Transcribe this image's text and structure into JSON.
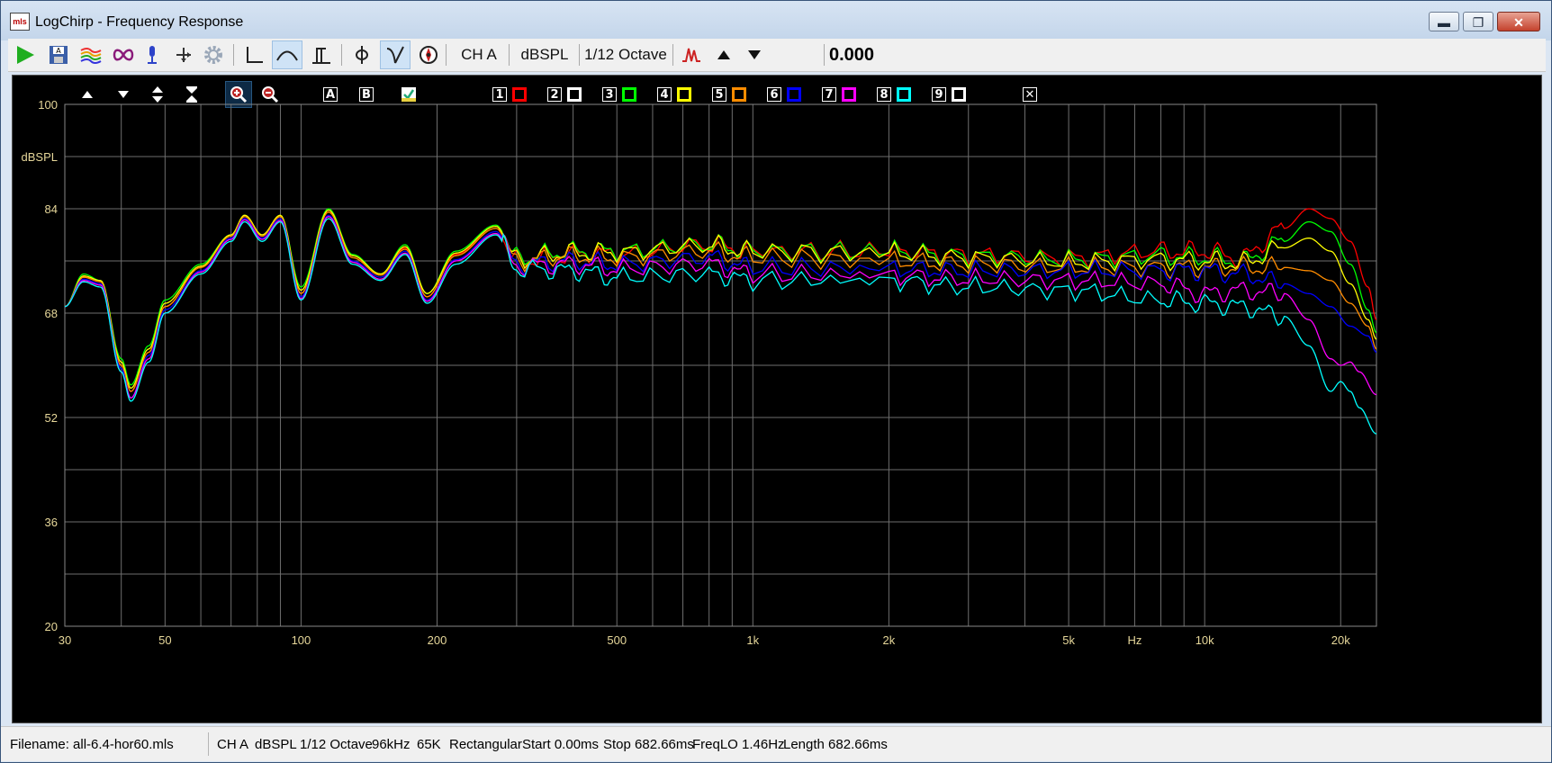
{
  "window": {
    "title": "LogChirp - Frequency Response",
    "app_icon_text": "mls",
    "minimize_label": "▬",
    "maximize_label": "❐",
    "close_label": "✕"
  },
  "toolbar": {
    "buttons": [
      {
        "name": "play-icon",
        "color": "#1fae1f"
      },
      {
        "name": "save-icon"
      },
      {
        "name": "multitrace-icon"
      },
      {
        "name": "infinity-icon"
      },
      {
        "name": "mic-icon"
      },
      {
        "name": "move-icon"
      },
      {
        "name": "gear-icon"
      },
      {
        "name": "impulse-icon"
      },
      {
        "name": "frequency-curve-icon",
        "pressed": true
      },
      {
        "name": "time-window-icon"
      },
      {
        "name": "phase-icon"
      },
      {
        "name": "smoothing-icon",
        "pressed": true
      },
      {
        "name": "compass-icon"
      }
    ],
    "channel": "CH A",
    "units": "dBSPL",
    "smoothing": "1/12 Octave",
    "offset_value": "0.000"
  },
  "plot_toolbar": {
    "labels": [
      "A",
      "B"
    ],
    "numbers": [
      "1",
      "2",
      "3",
      "4",
      "5",
      "6",
      "7",
      "8",
      "9"
    ],
    "trace_colors": [
      "#ff0000",
      "#ffffff",
      "#00ff00",
      "#ffff00",
      "#ff8c00",
      "#0000ff",
      "#ff00ff",
      "#00ffff",
      "#ffffff"
    ],
    "close_label": "✕"
  },
  "chart_data": {
    "type": "line",
    "ylabel": "dBSPL",
    "xlabel": "Hz",
    "x_scale": "log",
    "xlim": [
      30,
      24000
    ],
    "ylim": [
      20,
      100
    ],
    "y_ticks": [
      "100",
      "84",
      "68",
      "52",
      "36",
      "20"
    ],
    "x_ticks": [
      {
        "value": 30,
        "label": "30"
      },
      {
        "value": 50,
        "label": "50"
      },
      {
        "value": 100,
        "label": "100"
      },
      {
        "value": 200,
        "label": "200"
      },
      {
        "value": 500,
        "label": "500"
      },
      {
        "value": 1000,
        "label": "1k"
      },
      {
        "value": 2000,
        "label": "2k"
      },
      {
        "value": 5000,
        "label": "5k"
      },
      {
        "value": 7000,
        "label": "Hz"
      },
      {
        "value": 10000,
        "label": "10k"
      },
      {
        "value": 20000,
        "label": "20k"
      }
    ],
    "background": "#000000",
    "grid": true,
    "grid_color": "#6e6e6e",
    "tick_label_color": "#e6d79a",
    "series": [
      {
        "color": "#ff0000",
        "points": [
          [
            30,
            69
          ],
          [
            33,
            73.5
          ],
          [
            36,
            73
          ],
          [
            40,
            60
          ],
          [
            42,
            56
          ],
          [
            46,
            62
          ],
          [
            50,
            69
          ],
          [
            60,
            75
          ],
          [
            70,
            80
          ],
          [
            75,
            83
          ],
          [
            82,
            80
          ],
          [
            90,
            83
          ],
          [
            100,
            71
          ],
          [
            115,
            83.5
          ],
          [
            130,
            76.5
          ],
          [
            150,
            74
          ],
          [
            170,
            78
          ],
          [
            190,
            70.5
          ],
          [
            220,
            77
          ],
          [
            270,
            81
          ],
          [
            300,
            76
          ],
          [
            400,
            77
          ],
          [
            500,
            77
          ],
          [
            800,
            78.5
          ],
          [
            1000,
            77.5
          ],
          [
            2000,
            77.5
          ],
          [
            3000,
            77
          ],
          [
            5000,
            76.5
          ],
          [
            8000,
            77.5
          ],
          [
            10000,
            77.5
          ],
          [
            12000,
            76.5
          ],
          [
            15000,
            81
          ],
          [
            17000,
            84
          ],
          [
            19000,
            82.5
          ],
          [
            21000,
            79
          ],
          [
            23000,
            72
          ],
          [
            24000,
            67
          ]
        ]
      },
      {
        "color": "#00ff00",
        "points": [
          [
            30,
            69
          ],
          [
            33,
            74
          ],
          [
            36,
            73
          ],
          [
            40,
            61
          ],
          [
            42,
            57
          ],
          [
            46,
            63
          ],
          [
            50,
            70
          ],
          [
            60,
            75.5
          ],
          [
            70,
            80
          ],
          [
            75,
            83
          ],
          [
            82,
            80
          ],
          [
            90,
            83
          ],
          [
            100,
            72
          ],
          [
            115,
            84
          ],
          [
            130,
            77
          ],
          [
            150,
            74
          ],
          [
            170,
            78.5
          ],
          [
            190,
            71
          ],
          [
            220,
            77.5
          ],
          [
            270,
            81.5
          ],
          [
            300,
            76.5
          ],
          [
            400,
            77.5
          ],
          [
            500,
            77.5
          ],
          [
            800,
            78.5
          ],
          [
            1000,
            77.5
          ],
          [
            2000,
            77.5
          ],
          [
            3000,
            76.8
          ],
          [
            5000,
            76.2
          ],
          [
            8000,
            76.8
          ],
          [
            10000,
            76.5
          ],
          [
            12000,
            76
          ],
          [
            15000,
            79
          ],
          [
            17000,
            82
          ],
          [
            19000,
            80.5
          ],
          [
            21000,
            75.5
          ],
          [
            23000,
            68.5
          ],
          [
            24000,
            65
          ]
        ]
      },
      {
        "color": "#ffff00",
        "points": [
          [
            30,
            69
          ],
          [
            33,
            73.7
          ],
          [
            36,
            73
          ],
          [
            40,
            60.5
          ],
          [
            42,
            56.5
          ],
          [
            46,
            62.5
          ],
          [
            50,
            69.5
          ],
          [
            60,
            75.2
          ],
          [
            70,
            80
          ],
          [
            75,
            83
          ],
          [
            82,
            80
          ],
          [
            90,
            83
          ],
          [
            100,
            71.5
          ],
          [
            115,
            83.8
          ],
          [
            130,
            76.8
          ],
          [
            150,
            74
          ],
          [
            170,
            78.2
          ],
          [
            190,
            71
          ],
          [
            220,
            77.2
          ],
          [
            270,
            81.3
          ],
          [
            300,
            76.3
          ],
          [
            400,
            77.3
          ],
          [
            500,
            77.3
          ],
          [
            800,
            78.4
          ],
          [
            1000,
            77.4
          ],
          [
            2000,
            77.2
          ],
          [
            3000,
            76.5
          ],
          [
            5000,
            75.8
          ],
          [
            8000,
            76.2
          ],
          [
            10000,
            76
          ],
          [
            12000,
            75.7
          ],
          [
            15000,
            78
          ],
          [
            17000,
            79.5
          ],
          [
            19000,
            77.5
          ],
          [
            21000,
            72.5
          ],
          [
            23000,
            67
          ],
          [
            24000,
            64
          ]
        ]
      },
      {
        "color": "#ff8c00",
        "points": [
          [
            30,
            69
          ],
          [
            33,
            73.5
          ],
          [
            36,
            72.8
          ],
          [
            40,
            60
          ],
          [
            42,
            56
          ],
          [
            46,
            62
          ],
          [
            50,
            69
          ],
          [
            60,
            75
          ],
          [
            70,
            79.8
          ],
          [
            75,
            82.8
          ],
          [
            82,
            79.8
          ],
          [
            90,
            82.8
          ],
          [
            100,
            71
          ],
          [
            115,
            83.5
          ],
          [
            130,
            76.5
          ],
          [
            150,
            73.8
          ],
          [
            170,
            77.8
          ],
          [
            190,
            70.5
          ],
          [
            220,
            76.8
          ],
          [
            270,
            81
          ],
          [
            300,
            76
          ],
          [
            400,
            76.8
          ],
          [
            500,
            76.5
          ],
          [
            800,
            77.5
          ],
          [
            1000,
            76.5
          ],
          [
            2000,
            76
          ],
          [
            3000,
            75.5
          ],
          [
            5000,
            75
          ],
          [
            8000,
            75
          ],
          [
            10000,
            75
          ],
          [
            12000,
            75
          ],
          [
            15000,
            75
          ],
          [
            17000,
            74.5
          ],
          [
            19000,
            73
          ],
          [
            21000,
            69.5
          ],
          [
            23000,
            66
          ],
          [
            24000,
            62.5
          ]
        ]
      },
      {
        "color": "#0000ff",
        "points": [
          [
            30,
            69
          ],
          [
            33,
            73.2
          ],
          [
            36,
            72.5
          ],
          [
            40,
            59.5
          ],
          [
            42,
            55
          ],
          [
            46,
            61.5
          ],
          [
            50,
            68.5
          ],
          [
            60,
            74.5
          ],
          [
            70,
            79.5
          ],
          [
            75,
            82.5
          ],
          [
            82,
            79.5
          ],
          [
            90,
            82.5
          ],
          [
            100,
            70.5
          ],
          [
            115,
            83
          ],
          [
            130,
            76
          ],
          [
            150,
            73.5
          ],
          [
            170,
            77.5
          ],
          [
            190,
            70
          ],
          [
            220,
            76.2
          ],
          [
            270,
            80.5
          ],
          [
            300,
            75.5
          ],
          [
            400,
            76
          ],
          [
            500,
            75.5
          ],
          [
            800,
            76.5
          ],
          [
            1000,
            75
          ],
          [
            2000,
            74.8
          ],
          [
            3000,
            74.5
          ],
          [
            5000,
            74.5
          ],
          [
            8000,
            74.5
          ],
          [
            10000,
            74.5
          ],
          [
            12000,
            74
          ],
          [
            15000,
            72.5
          ],
          [
            17000,
            71
          ],
          [
            19000,
            69
          ],
          [
            21000,
            66
          ],
          [
            23000,
            64.5
          ],
          [
            24000,
            62
          ]
        ]
      },
      {
        "color": "#ff00ff",
        "points": [
          [
            30,
            69
          ],
          [
            33,
            73
          ],
          [
            36,
            72.3
          ],
          [
            40,
            59
          ],
          [
            42,
            55
          ],
          [
            46,
            61
          ],
          [
            50,
            68
          ],
          [
            60,
            74.3
          ],
          [
            70,
            79.3
          ],
          [
            75,
            82.3
          ],
          [
            82,
            79.3
          ],
          [
            90,
            82.2
          ],
          [
            100,
            70.2
          ],
          [
            115,
            82.8
          ],
          [
            130,
            75.8
          ],
          [
            150,
            73.2
          ],
          [
            170,
            77.2
          ],
          [
            190,
            69.8
          ],
          [
            220,
            76
          ],
          [
            270,
            80.2
          ],
          [
            300,
            75.2
          ],
          [
            400,
            75.5
          ],
          [
            500,
            74.8
          ],
          [
            800,
            75.5
          ],
          [
            1000,
            74
          ],
          [
            2000,
            73.8
          ],
          [
            3000,
            73.2
          ],
          [
            5000,
            73
          ],
          [
            8000,
            72.5
          ],
          [
            10000,
            71
          ],
          [
            12000,
            71.5
          ],
          [
            15000,
            71
          ],
          [
            17000,
            67
          ],
          [
            19000,
            61
          ],
          [
            20000,
            60
          ],
          [
            21000,
            60.5
          ],
          [
            22000,
            59
          ],
          [
            24000,
            55.5
          ]
        ]
      },
      {
        "color": "#00ffff",
        "points": [
          [
            30,
            69
          ],
          [
            33,
            72.8
          ],
          [
            36,
            72
          ],
          [
            40,
            59
          ],
          [
            42,
            54.5
          ],
          [
            46,
            60.5
          ],
          [
            50,
            68
          ],
          [
            60,
            74
          ],
          [
            70,
            79
          ],
          [
            75,
            82
          ],
          [
            82,
            79
          ],
          [
            90,
            82
          ],
          [
            100,
            70
          ],
          [
            115,
            82.5
          ],
          [
            130,
            75.5
          ],
          [
            150,
            73
          ],
          [
            170,
            77
          ],
          [
            190,
            69.5
          ],
          [
            220,
            75.5
          ],
          [
            270,
            80
          ],
          [
            300,
            74.8
          ],
          [
            400,
            74.5
          ],
          [
            500,
            73.5
          ],
          [
            800,
            74
          ],
          [
            1000,
            73
          ],
          [
            2000,
            73
          ],
          [
            3000,
            72
          ],
          [
            5000,
            71.5
          ],
          [
            8000,
            70
          ],
          [
            10000,
            69.5
          ],
          [
            12000,
            69
          ],
          [
            15000,
            67.5
          ],
          [
            17000,
            63
          ],
          [
            19000,
            56
          ],
          [
            20000,
            57.5
          ],
          [
            21000,
            56
          ],
          [
            22000,
            53.5
          ],
          [
            24000,
            49.5
          ]
        ]
      }
    ]
  },
  "status": {
    "filename": "Filename: all-6.4-hor60.mls",
    "channel": "CH A",
    "units": "dBSPL",
    "smoothing": "1/12 Octave",
    "rate": "96kHz",
    "size": "65K",
    "window": "Rectangular",
    "start": "Start 0.00ms",
    "stop": "Stop 682.66ms",
    "freqlo": "FreqLO 1.46Hz",
    "length": "Length 682.66ms"
  }
}
